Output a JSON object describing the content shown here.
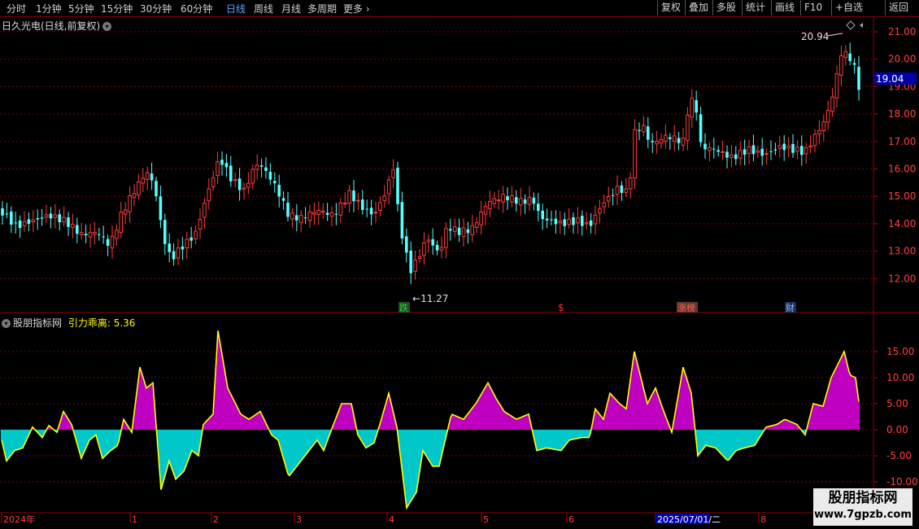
{
  "toolbar": {
    "periods": [
      "分时",
      "1分钟",
      "5分钟",
      "15分钟",
      "30分钟",
      "60分钟",
      "日线",
      "周线",
      "月线",
      "多周期",
      "更多"
    ],
    "more_arrow": "›",
    "active_period": "日线",
    "right_buttons": [
      "复权",
      "叠加",
      "多股",
      "统计",
      "画线",
      "F10",
      "+自选",
      "返回"
    ]
  },
  "main_panel": {
    "title": "日久光电(日线,前复权)",
    "price_labels": [
      "21.00",
      "20.00",
      "19.00",
      "18.00",
      "17.00",
      "16.00",
      "15.00",
      "14.00",
      "13.00",
      "12.00"
    ],
    "current_price": "19.04",
    "high_marker": "20.94",
    "low_marker": "11.27",
    "event_tags": [
      {
        "text": "跌",
        "color": "#2ea043",
        "bg": "#1d4d1d"
      },
      {
        "text": "$",
        "color": "#ff3030",
        "bg": ""
      },
      {
        "text": "涨榜",
        "color": "#ff5050",
        "bg": "#5a3a2a"
      },
      {
        "text": "财",
        "color": "#8fb8ff",
        "bg": "#1c2f55"
      }
    ]
  },
  "indicator_panel": {
    "title": "股朋指标网",
    "indicator_name": "引力乖离:",
    "indicator_value": "5.36",
    "axis_labels": [
      "15.00",
      "10.00",
      "5.00",
      "0.00",
      "-5.00",
      "-10.00"
    ]
  },
  "time_axis": {
    "labels": [
      "2024年",
      "1",
      "2",
      "3",
      "4",
      "5",
      "6",
      "2025/07/01/二",
      "8"
    ]
  },
  "watermark": {
    "line1": "股朋指标网",
    "line2": "www.7gpzb.com"
  },
  "colors": {
    "up": "#ff3c3c",
    "down": "#54ffff",
    "positive_fill": "#c000c0",
    "negative_fill": "#00c8c8",
    "indicator_line": "#ffff00",
    "grid": "#7a0000"
  }
}
